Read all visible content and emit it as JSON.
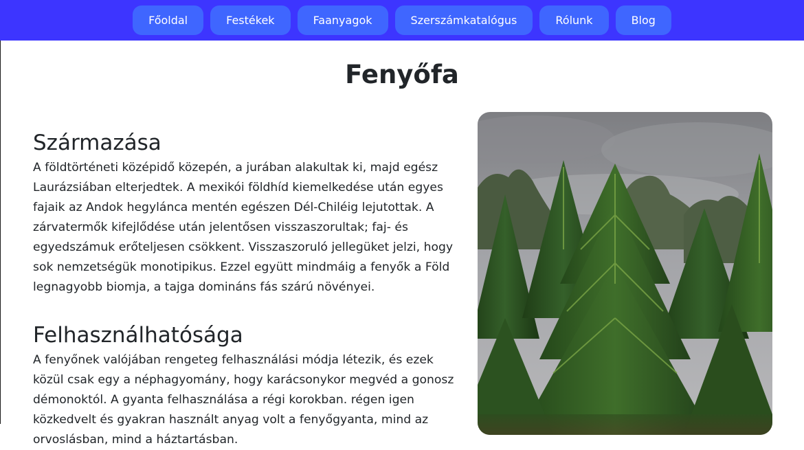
{
  "nav": {
    "items": [
      {
        "label": "Főoldal"
      },
      {
        "label": "Festékek"
      },
      {
        "label": "Faanyagok"
      },
      {
        "label": "Szerszámkatalógus"
      },
      {
        "label": "Rólunk"
      },
      {
        "label": "Blog"
      }
    ]
  },
  "page": {
    "title": "Fenyőfa"
  },
  "sections": [
    {
      "heading": "Származása",
      "text": "A földtörténeti középidő közepén, a jurában alakultak ki, majd egész Laurázsiában elterjedtek. A mexikói földhíd kiemelkedése után egyes fajaik az Andok hegylánca mentén egészen Dél-Chiléig lejutottak. A zárvatermők kifejlődése után jelentősen visszaszorultak; faj- és egyedszámuk erőteljesen csökkent. Visszaszoruló jellegüket jelzi, hogy sok nemzetségük monotipikus. Ezzel együtt mindmáig a fenyők a Föld legnagyobb biomja, a tajga domináns fás szárú növényei."
    },
    {
      "heading": "Felhasználhatósága",
      "text": "A fenyőnek valójában rengeteg felhasználási módja létezik, és ezek közül csak egy a néphagyomány, hogy karácsonykor megvéd a gonosz démonoktól. A gyanta felhasználása a régi korokban. régen igen közkedvelt és gyakran használt anyag volt a fenyőgyanta, mind az orvoslásban, mind a háztartásban."
    }
  ],
  "image": {
    "icon": "fir-trees-photo",
    "colors": {
      "sky": "#8f9094",
      "foliage": "#2f5a22",
      "highlight": "#6f9a3c"
    }
  }
}
